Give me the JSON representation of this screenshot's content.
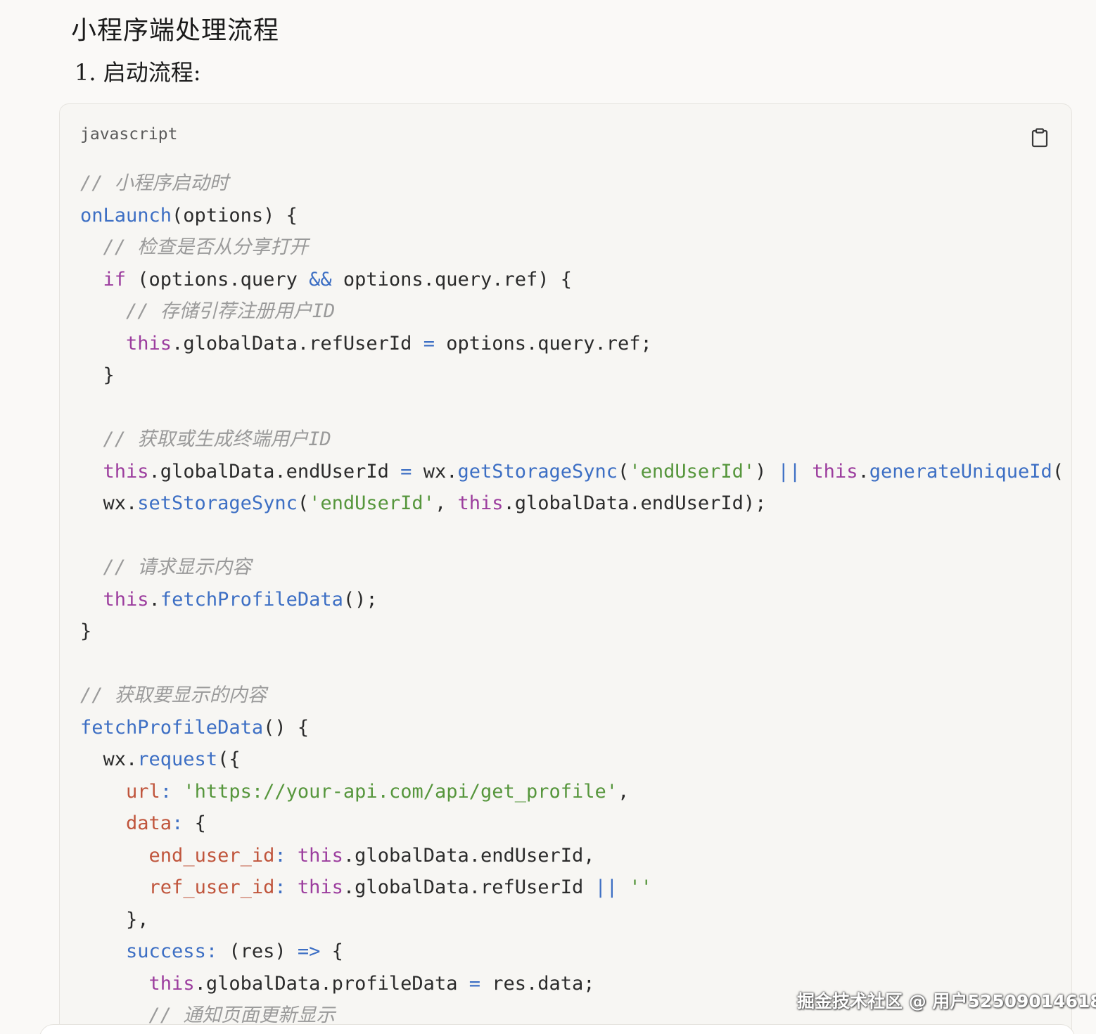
{
  "document": {
    "title": "小程序端处理流程",
    "subtitle": "1. 启动流程:"
  },
  "code_block": {
    "language": "javascript",
    "copy_icon": "clipboard-icon",
    "lines": [
      [
        {
          "t": "// 小程序启动时",
          "c": "com"
        }
      ],
      [
        {
          "t": "onLaunch",
          "c": "fn"
        },
        {
          "t": "(options) {",
          "c": "pun"
        }
      ],
      [
        {
          "t": "  ",
          "c": "pun"
        },
        {
          "t": "// 检查是否从分享打开",
          "c": "com"
        }
      ],
      [
        {
          "t": "  ",
          "c": "pun"
        },
        {
          "t": "if",
          "c": "kw"
        },
        {
          "t": " (options.query ",
          "c": "pun"
        },
        {
          "t": "&&",
          "c": "op"
        },
        {
          "t": " options.query.ref) {",
          "c": "pun"
        }
      ],
      [
        {
          "t": "    ",
          "c": "pun"
        },
        {
          "t": "// 存储引荐注册用户ID",
          "c": "com"
        }
      ],
      [
        {
          "t": "    ",
          "c": "pun"
        },
        {
          "t": "this",
          "c": "kw"
        },
        {
          "t": ".globalData.refUserId ",
          "c": "pun"
        },
        {
          "t": "=",
          "c": "op"
        },
        {
          "t": " options.query.ref;",
          "c": "pun"
        }
      ],
      [
        {
          "t": "  }",
          "c": "pun"
        }
      ],
      [
        {
          "t": "",
          "c": "pun"
        }
      ],
      [
        {
          "t": "  ",
          "c": "pun"
        },
        {
          "t": "// 获取或生成终端用户ID",
          "c": "com"
        }
      ],
      [
        {
          "t": "  ",
          "c": "pun"
        },
        {
          "t": "this",
          "c": "kw"
        },
        {
          "t": ".globalData.endUserId ",
          "c": "pun"
        },
        {
          "t": "=",
          "c": "op"
        },
        {
          "t": " wx.",
          "c": "pun"
        },
        {
          "t": "getStorageSync",
          "c": "fn"
        },
        {
          "t": "(",
          "c": "pun"
        },
        {
          "t": "'endUserId'",
          "c": "str"
        },
        {
          "t": ") ",
          "c": "pun"
        },
        {
          "t": "||",
          "c": "op"
        },
        {
          "t": " ",
          "c": "pun"
        },
        {
          "t": "this",
          "c": "kw"
        },
        {
          "t": ".",
          "c": "pun"
        },
        {
          "t": "generateUniqueId",
          "c": "fn"
        },
        {
          "t": "(",
          "c": "pun"
        }
      ],
      [
        {
          "t": "  wx.",
          "c": "pun"
        },
        {
          "t": "setStorageSync",
          "c": "fn"
        },
        {
          "t": "(",
          "c": "pun"
        },
        {
          "t": "'endUserId'",
          "c": "str"
        },
        {
          "t": ", ",
          "c": "pun"
        },
        {
          "t": "this",
          "c": "kw"
        },
        {
          "t": ".globalData.endUserId);",
          "c": "pun"
        }
      ],
      [
        {
          "t": "",
          "c": "pun"
        }
      ],
      [
        {
          "t": "  ",
          "c": "pun"
        },
        {
          "t": "// 请求显示内容",
          "c": "com"
        }
      ],
      [
        {
          "t": "  ",
          "c": "pun"
        },
        {
          "t": "this",
          "c": "kw"
        },
        {
          "t": ".",
          "c": "pun"
        },
        {
          "t": "fetchProfileData",
          "c": "fn"
        },
        {
          "t": "();",
          "c": "pun"
        }
      ],
      [
        {
          "t": "}",
          "c": "pun"
        }
      ],
      [
        {
          "t": "",
          "c": "pun"
        }
      ],
      [
        {
          "t": "// 获取要显示的内容",
          "c": "com"
        }
      ],
      [
        {
          "t": "fetchProfileData",
          "c": "fn"
        },
        {
          "t": "() {",
          "c": "pun"
        }
      ],
      [
        {
          "t": "  wx.",
          "c": "pun"
        },
        {
          "t": "request",
          "c": "fn"
        },
        {
          "t": "({",
          "c": "pun"
        }
      ],
      [
        {
          "t": "    ",
          "c": "pun"
        },
        {
          "t": "url",
          "c": "prop"
        },
        {
          "t": ":",
          "c": "op"
        },
        {
          "t": " ",
          "c": "pun"
        },
        {
          "t": "'https://your-api.com/api/get_profile'",
          "c": "str"
        },
        {
          "t": ",",
          "c": "pun"
        }
      ],
      [
        {
          "t": "    ",
          "c": "pun"
        },
        {
          "t": "data",
          "c": "prop"
        },
        {
          "t": ":",
          "c": "op"
        },
        {
          "t": " {",
          "c": "pun"
        }
      ],
      [
        {
          "t": "      ",
          "c": "pun"
        },
        {
          "t": "end_user_id",
          "c": "prop"
        },
        {
          "t": ":",
          "c": "op"
        },
        {
          "t": " ",
          "c": "pun"
        },
        {
          "t": "this",
          "c": "kw"
        },
        {
          "t": ".globalData.endUserId,",
          "c": "pun"
        }
      ],
      [
        {
          "t": "      ",
          "c": "pun"
        },
        {
          "t": "ref_user_id",
          "c": "prop"
        },
        {
          "t": ":",
          "c": "op"
        },
        {
          "t": " ",
          "c": "pun"
        },
        {
          "t": "this",
          "c": "kw"
        },
        {
          "t": ".globalData.refUserId ",
          "c": "pun"
        },
        {
          "t": "||",
          "c": "op"
        },
        {
          "t": " ",
          "c": "pun"
        },
        {
          "t": "''",
          "c": "str"
        }
      ],
      [
        {
          "t": "    },",
          "c": "pun"
        }
      ],
      [
        {
          "t": "    ",
          "c": "pun"
        },
        {
          "t": "success",
          "c": "fn"
        },
        {
          "t": ":",
          "c": "op"
        },
        {
          "t": " (res) ",
          "c": "pun"
        },
        {
          "t": "=>",
          "c": "op"
        },
        {
          "t": " {",
          "c": "pun"
        }
      ],
      [
        {
          "t": "      ",
          "c": "pun"
        },
        {
          "t": "this",
          "c": "kw"
        },
        {
          "t": ".globalData.profileData ",
          "c": "pun"
        },
        {
          "t": "=",
          "c": "op"
        },
        {
          "t": " res.data;",
          "c": "pun"
        }
      ],
      [
        {
          "t": "      ",
          "c": "pun"
        },
        {
          "t": "// 通知页面更新显示",
          "c": "com"
        }
      ]
    ]
  },
  "watermark": "掘金技术社区 @ 用户52509014618"
}
